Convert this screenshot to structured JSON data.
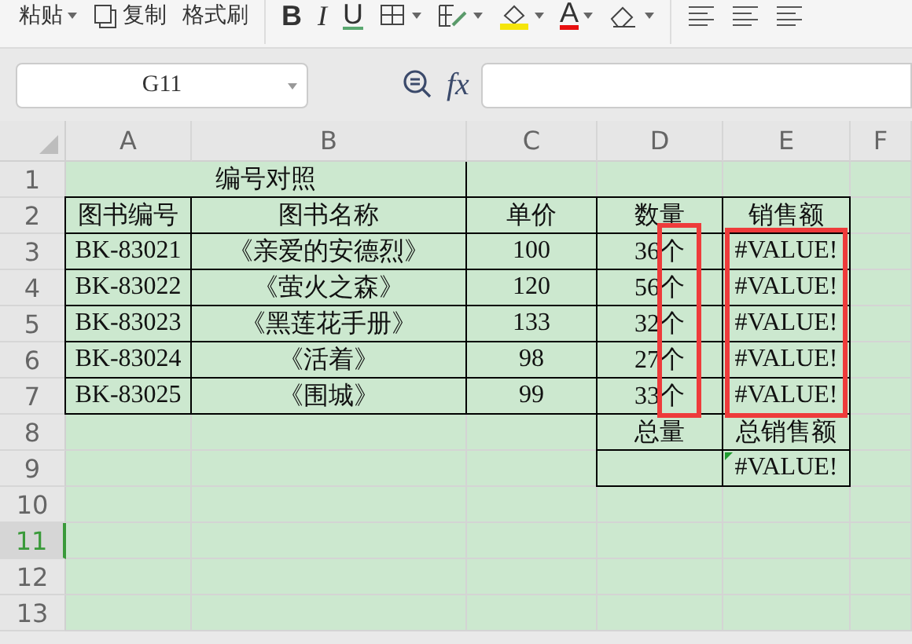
{
  "toolbar": [
    {
      "kind": "text",
      "label": "粘贴",
      "caret": true
    },
    {
      "kind": "copy",
      "label": "复制",
      "caret": false
    },
    {
      "kind": "text",
      "label": "格式刷",
      "caret": false
    },
    {
      "kind": "sep"
    },
    {
      "kind": "bold",
      "label": "B",
      "caret": false
    },
    {
      "kind": "italic",
      "label": "I",
      "caret": false
    },
    {
      "kind": "underline",
      "label": "U",
      "caret": false
    },
    {
      "kind": "border",
      "caret": true
    },
    {
      "kind": "merge",
      "caret": true
    },
    {
      "kind": "fill",
      "caret": true
    },
    {
      "kind": "fontcolor",
      "label": "A",
      "caret": true
    },
    {
      "kind": "eraser",
      "caret": true
    },
    {
      "kind": "sep"
    },
    {
      "kind": "align"
    },
    {
      "kind": "align"
    },
    {
      "kind": "align"
    }
  ],
  "name_box": {
    "value": "G11"
  },
  "formula_bar": {
    "function_label": "fx"
  },
  "columns": [
    {
      "label": "A",
      "selected": false
    },
    {
      "label": "B",
      "selected": false
    },
    {
      "label": "C",
      "selected": false
    },
    {
      "label": "D",
      "selected": false
    },
    {
      "label": "E",
      "selected": false
    },
    {
      "label": "F",
      "selected": false
    }
  ],
  "rows": [
    {
      "label": "1",
      "selected": false,
      "cells": [
        {
          "text": "编号对照",
          "span": true,
          "bordered": false
        },
        {
          "text": "",
          "bordered": false
        },
        {
          "text": "",
          "bordered": false
        },
        {
          "text": "",
          "bordered": false
        },
        {
          "text": "",
          "bordered": false
        }
      ]
    },
    {
      "label": "2",
      "selected": false,
      "cells": [
        {
          "text": "图书编号",
          "bordered": true
        },
        {
          "text": "图书名称",
          "bordered": true
        },
        {
          "text": "单价",
          "bordered": true
        },
        {
          "text": "数量",
          "bordered": true
        },
        {
          "text": "销售额",
          "bordered": true
        },
        {
          "text": "",
          "bordered": false
        }
      ]
    },
    {
      "label": "3",
      "selected": false,
      "cells": [
        {
          "text": "BK-83021",
          "bordered": true
        },
        {
          "text": "《亲爱的安德烈》",
          "bordered": true
        },
        {
          "text": "100",
          "bordered": true
        },
        {
          "text": "36个",
          "bordered": true
        },
        {
          "text": "#VALUE!",
          "bordered": true
        },
        {
          "text": "",
          "bordered": false
        }
      ]
    },
    {
      "label": "4",
      "selected": false,
      "cells": [
        {
          "text": "BK-83022",
          "bordered": true
        },
        {
          "text": "《萤火之森》",
          "bordered": true
        },
        {
          "text": "120",
          "bordered": true
        },
        {
          "text": "56个",
          "bordered": true
        },
        {
          "text": "#VALUE!",
          "bordered": true
        },
        {
          "text": "",
          "bordered": false
        }
      ]
    },
    {
      "label": "5",
      "selected": false,
      "cells": [
        {
          "text": "BK-83023",
          "bordered": true
        },
        {
          "text": "《黑莲花手册》",
          "bordered": true
        },
        {
          "text": "133",
          "bordered": true
        },
        {
          "text": "32个",
          "bordered": true
        },
        {
          "text": "#VALUE!",
          "bordered": true
        },
        {
          "text": "",
          "bordered": false
        }
      ]
    },
    {
      "label": "6",
      "selected": false,
      "cells": [
        {
          "text": "BK-83024",
          "bordered": true
        },
        {
          "text": "《活着》",
          "bordered": true
        },
        {
          "text": "98",
          "bordered": true
        },
        {
          "text": "27个",
          "bordered": true
        },
        {
          "text": "#VALUE!",
          "bordered": true
        },
        {
          "text": "",
          "bordered": false
        }
      ]
    },
    {
      "label": "7",
      "selected": false,
      "cells": [
        {
          "text": "BK-83025",
          "bordered": true
        },
        {
          "text": "《围城》",
          "bordered": true
        },
        {
          "text": "99",
          "bordered": true
        },
        {
          "text": "33个",
          "bordered": true
        },
        {
          "text": "#VALUE!",
          "bordered": true
        },
        {
          "text": "",
          "bordered": false
        }
      ]
    },
    {
      "label": "8",
      "selected": false,
      "cells": [
        {
          "text": "",
          "bordered": false
        },
        {
          "text": "",
          "bordered": false
        },
        {
          "text": "",
          "bordered": false
        },
        {
          "text": "总量",
          "bordered": true
        },
        {
          "text": "总销售额",
          "bordered": true
        },
        {
          "text": "",
          "bordered": false
        }
      ]
    },
    {
      "label": "9",
      "selected": false,
      "cells": [
        {
          "text": "",
          "bordered": false
        },
        {
          "text": "",
          "bordered": false
        },
        {
          "text": "",
          "bordered": false
        },
        {
          "text": "",
          "bordered": true
        },
        {
          "text": "#VALUE!",
          "bordered": true,
          "error_flag": true
        },
        {
          "text": "",
          "bordered": false
        }
      ]
    },
    {
      "label": "10",
      "selected": false,
      "cells": []
    },
    {
      "label": "11",
      "selected": true,
      "cells": []
    },
    {
      "label": "12",
      "selected": false,
      "cells": []
    },
    {
      "label": "13",
      "selected": false,
      "cells": []
    }
  ]
}
